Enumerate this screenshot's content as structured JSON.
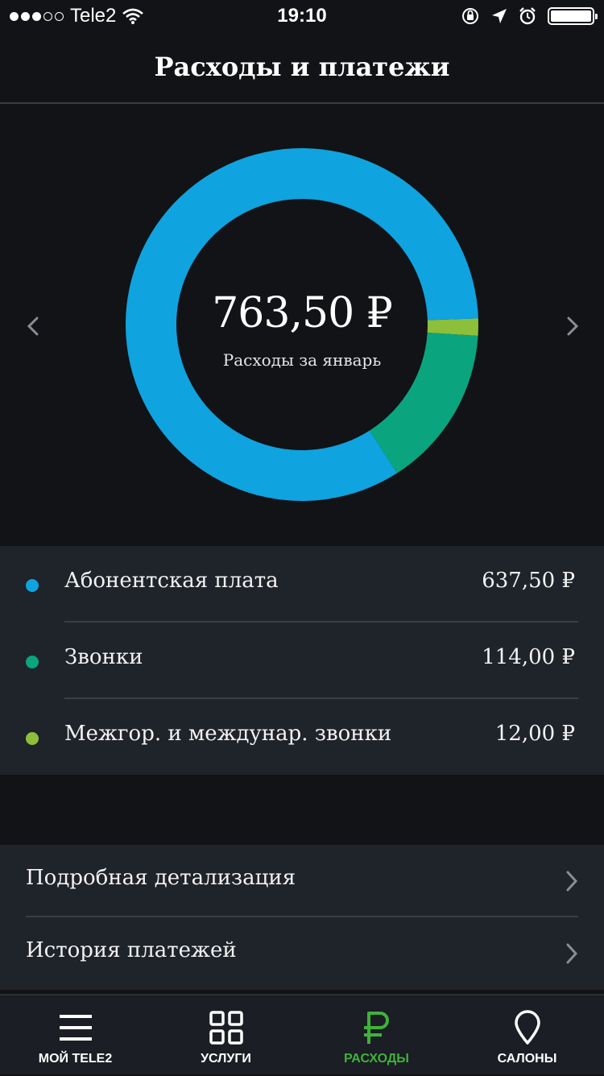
{
  "status_bar": {
    "carrier": "Tele2",
    "time": "19:10",
    "signal_bars_filled": 3,
    "signal_bars_total": 5
  },
  "header": {
    "title": "Расходы и платежи"
  },
  "chart_data": {
    "type": "pie",
    "total_label": "763,50 ₽",
    "subtitle": "Расходы за январь",
    "slices": [
      {
        "name": "Абонентская плата",
        "value": 637.5,
        "value_label": "637,50 ₽",
        "color": "#0fa3df"
      },
      {
        "name": "Звонки",
        "value": 114.0,
        "value_label": "114,00 ₽",
        "color": "#0aa57e"
      },
      {
        "name": "Межгор. и междунар. звонки",
        "value": 12.0,
        "value_label": "12,00 ₽",
        "color": "#8dbf3b"
      }
    ]
  },
  "links": [
    {
      "label": "Подробная детализация"
    },
    {
      "label": "История платежей"
    }
  ],
  "tab_bar": {
    "tabs": [
      {
        "label": "МОЙ TELE2",
        "icon": "menu-icon",
        "active": false
      },
      {
        "label": "УСЛУГИ",
        "icon": "grid-icon",
        "active": false
      },
      {
        "label": "РАСХОДЫ",
        "icon": "ruble-icon",
        "active": true
      },
      {
        "label": "САЛОНЫ",
        "icon": "location-pin-icon",
        "active": false
      }
    ]
  },
  "colors": {
    "background": "#121316",
    "panel": "#1f232a",
    "accent_active": "#3fb23a"
  }
}
